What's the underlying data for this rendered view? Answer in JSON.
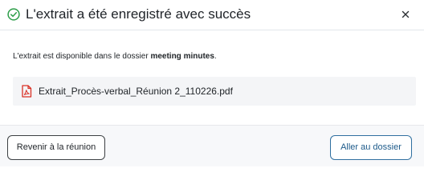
{
  "dialog": {
    "title": "L'extrait a été enregistré avec succès",
    "message_prefix": "L'extrait est disponible dans le dossier ",
    "folder_name": "meeting minutes",
    "message_suffix": ".",
    "file": {
      "name": "Extrait_Procès-verbal_Réunion 2_110226.pdf",
      "icon": "pdf-file-icon"
    },
    "buttons": {
      "back_label": "Revenir à la réunion",
      "go_folder_label": "Aller au dossier"
    },
    "icons": {
      "success": "check-circle-icon",
      "close": "close-icon"
    },
    "colors": {
      "success": "#2e9e4a",
      "pdf": "#d93025",
      "primary": "#1c5a8a"
    }
  }
}
